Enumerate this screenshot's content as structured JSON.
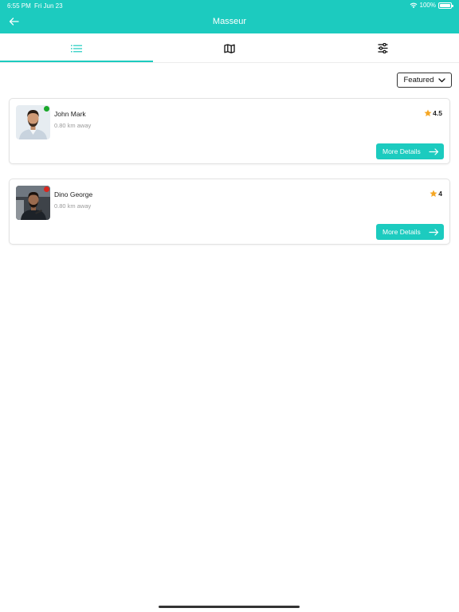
{
  "status_bar": {
    "time": "6:55 PM",
    "date": "Fri Jun 23",
    "battery": "100%"
  },
  "header": {
    "title": "Masseur"
  },
  "tabs": [
    {
      "icon": "list-icon",
      "active": true
    },
    {
      "icon": "map-icon",
      "active": false
    },
    {
      "icon": "sliders-icon",
      "active": false
    }
  ],
  "sort": {
    "label": "Featured"
  },
  "providers": [
    {
      "name": "John Mark",
      "distance": "0.80 km away",
      "rating": "4.5",
      "online": true,
      "status_color": "#1aa82b",
      "button_label": "More Details"
    },
    {
      "name": "Dino George",
      "distance": "0.80 km away",
      "rating": "4",
      "online": false,
      "status_color": "#d9271e",
      "button_label": "More Details"
    }
  ],
  "colors": {
    "accent": "#1ccbbf",
    "star": "#f5a623"
  }
}
